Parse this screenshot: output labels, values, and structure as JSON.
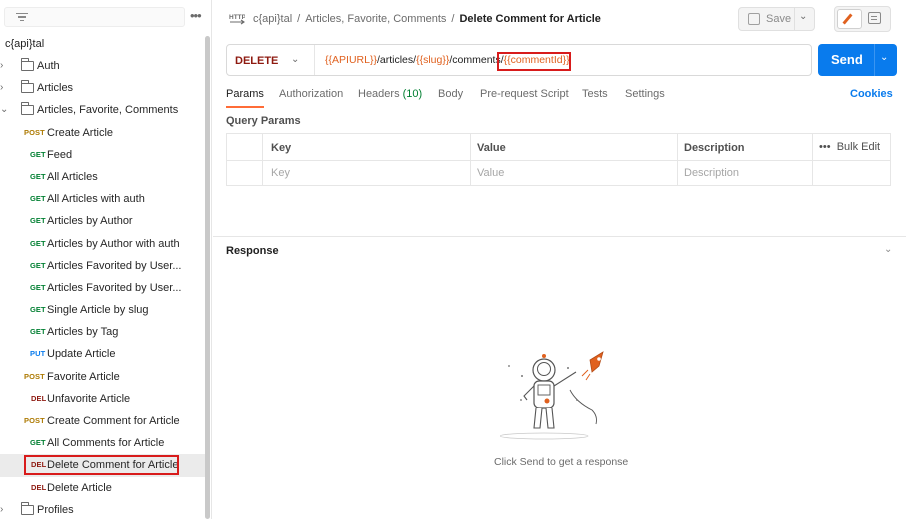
{
  "sidebar": {
    "workspace_title": "c{api}tal",
    "tree": [
      {
        "type": "folder",
        "label": "Auth",
        "expanded": false
      },
      {
        "type": "folder",
        "label": "Articles",
        "expanded": false
      },
      {
        "type": "folder",
        "label": "Articles, Favorite, Comments",
        "expanded": true
      },
      {
        "type": "request",
        "method": "POST",
        "label": "Create Article"
      },
      {
        "type": "request",
        "method": "GET",
        "label": "Feed"
      },
      {
        "type": "request",
        "method": "GET",
        "label": "All Articles"
      },
      {
        "type": "request",
        "method": "GET",
        "label": "All Articles with auth"
      },
      {
        "type": "request",
        "method": "GET",
        "label": "Articles by Author"
      },
      {
        "type": "request",
        "method": "GET",
        "label": "Articles by Author with auth"
      },
      {
        "type": "request",
        "method": "GET",
        "label": "Articles Favorited by User..."
      },
      {
        "type": "request",
        "method": "GET",
        "label": "Articles Favorited by User..."
      },
      {
        "type": "request",
        "method": "GET",
        "label": "Single Article by slug"
      },
      {
        "type": "request",
        "method": "GET",
        "label": "Articles by Tag"
      },
      {
        "type": "request",
        "method": "PUT",
        "label": "Update Article"
      },
      {
        "type": "request",
        "method": "POST",
        "label": "Favorite Article"
      },
      {
        "type": "request",
        "method": "DEL",
        "label": "Unfavorite Article"
      },
      {
        "type": "request",
        "method": "POST",
        "label": "Create Comment for Article"
      },
      {
        "type": "request",
        "method": "GET",
        "label": "All Comments for Article"
      },
      {
        "type": "request",
        "method": "DEL",
        "label": "Delete Comment for Article",
        "selected": true
      },
      {
        "type": "request",
        "method": "DEL",
        "label": "Delete Article"
      },
      {
        "type": "folder",
        "label": "Profiles",
        "expanded": false
      }
    ]
  },
  "header": {
    "breadcrumb": [
      "c{api}tal",
      "Articles, Favorite, Comments"
    ],
    "current": "Delete Comment for Article",
    "save_label": "Save"
  },
  "request": {
    "method": "DELETE",
    "url": {
      "var_apiurl": "{{APIURL}}",
      "seg1": "/articles/",
      "var_slug": "{{slug}}",
      "seg2": "/comments/",
      "var_commentid": "{{commentId}}"
    },
    "send_label": "Send"
  },
  "tabs": {
    "params": "Params",
    "authorization": "Authorization",
    "headers": "Headers",
    "headers_count": "(10)",
    "body": "Body",
    "prerequest": "Pre-request Script",
    "tests": "Tests",
    "settings": "Settings",
    "cookies": "Cookies"
  },
  "query_params": {
    "title": "Query Params",
    "columns": [
      "Key",
      "Value",
      "Description"
    ],
    "placeholders": [
      "Key",
      "Value",
      "Description"
    ],
    "bulk_edit": "Bulk Edit"
  },
  "response": {
    "title": "Response",
    "empty_message": "Click Send to get a response"
  },
  "colors": {
    "accent_orange": "#ff6c37",
    "send_blue": "#097bed",
    "method_get": "#007f31",
    "method_post": "#ad7a03",
    "method_put": "#097bed",
    "method_del": "#8e1a10",
    "variable": "#e0611f",
    "highlight_box": "#d81b1b"
  }
}
